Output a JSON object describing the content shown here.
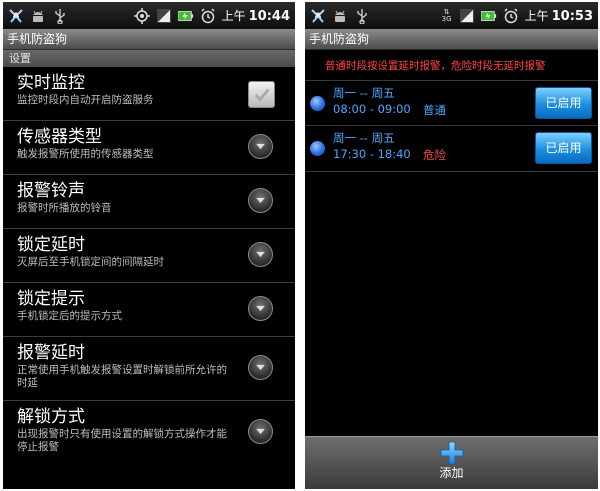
{
  "left": {
    "status": {
      "am_pm": "上午",
      "time": "10:44"
    },
    "title": "手机防盗狗",
    "section": "设置",
    "prefs": [
      {
        "title": "实时监控",
        "summary": "监控时段内自动开启防盗服务",
        "control": "checkbox"
      },
      {
        "title": "传感器类型",
        "summary": "触发报警所使用的传感器类型",
        "control": "arrow"
      },
      {
        "title": "报警铃声",
        "summary": "报警时所播放的铃音",
        "control": "arrow"
      },
      {
        "title": "锁定延时",
        "summary": "灭屏后至手机锁定间的间隔延时",
        "control": "arrow"
      },
      {
        "title": "锁定提示",
        "summary": "手机锁定后的提示方式",
        "control": "arrow"
      },
      {
        "title": "报警延时",
        "summary": "正常使用手机触发报警设置时解锁前所允许的时延",
        "control": "arrow"
      },
      {
        "title": "解锁方式",
        "summary": "出现报警时只有使用设置的解锁方式操作才能停止报警",
        "control": "arrow"
      }
    ]
  },
  "right": {
    "status": {
      "net": "3G",
      "am_pm": "上午",
      "time": "10:53"
    },
    "title": "手机防盗狗",
    "notice": "普通时段按设置延时报警，危险时段无延时报警",
    "schedules": [
      {
        "days": "周一 -- 周五",
        "time": "08:00 - 09:00",
        "level": "普通",
        "level_color": "#49a8ff",
        "button": "已启用"
      },
      {
        "days": "周一 -- 周五",
        "time": "17:30 - 18:40",
        "level": "危险",
        "level_color": "#ff4a4a",
        "button": "已启用"
      }
    ],
    "add_label": "添加"
  },
  "colors": {
    "accent_blue": "#49a8ff",
    "danger_red": "#ff4a4a",
    "notice_red": "#ff4444"
  }
}
